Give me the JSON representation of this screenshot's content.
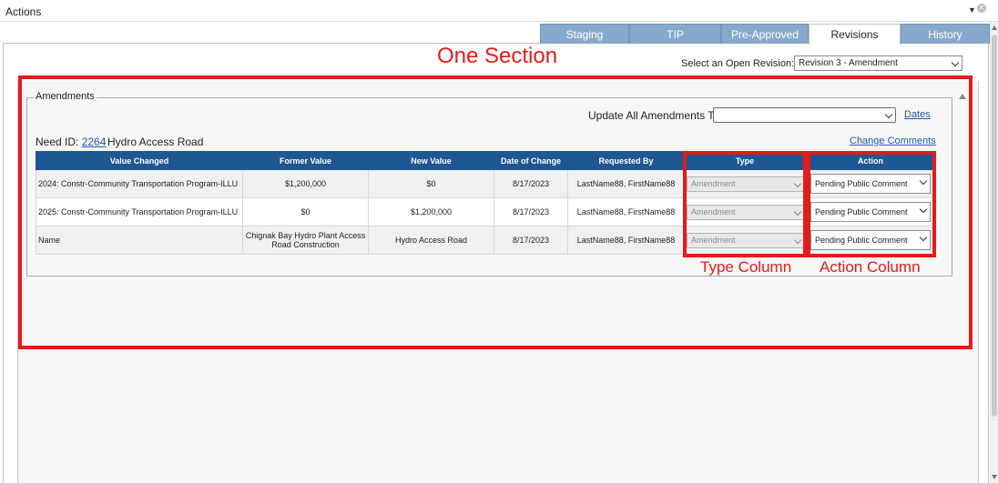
{
  "window": {
    "title": "Actions"
  },
  "tabs": [
    {
      "label": "Staging",
      "active": false
    },
    {
      "label": "TIP",
      "active": false
    },
    {
      "label": "Pre-Approved",
      "active": false
    },
    {
      "label": "Revisions",
      "active": true
    },
    {
      "label": "History",
      "active": false
    }
  ],
  "revision": {
    "label": "Select an Open Revision:",
    "selected": "Revision 3 - Amendment"
  },
  "annotations": {
    "section_title": "One Section",
    "type_column": "Type Column",
    "action_column": "Action Column",
    "color": "#e41b1b"
  },
  "amendments": {
    "legend": "Amendments",
    "update_all_label": "Update All Amendments To:",
    "update_all_value": "",
    "dates_link": "Dates",
    "need_id_label": "Need ID:",
    "need_id": "2264",
    "need_name": "Hydro Access Road",
    "change_comments_link": "Change Comments",
    "columns": [
      "Value Changed",
      "Former Value",
      "New Value",
      "Date of Change",
      "Requested By",
      "Type",
      "Action"
    ],
    "rows": [
      {
        "value_changed": "2024: Constr-Community Transportation Program-ILLU",
        "former_value": "$1,200,000",
        "new_value": "$0",
        "date_of_change": "8/17/2023",
        "requested_by": "LastName88, FirstName88",
        "type": "Amendment",
        "action": "Pending Public Comment"
      },
      {
        "value_changed": "2025: Constr-Community Transportation Program-ILLU",
        "former_value": "$0",
        "new_value": "$1,200,000",
        "date_of_change": "8/17/2023",
        "requested_by": "LastName88, FirstName88",
        "type": "Amendment",
        "action": "Pending Public Comment"
      },
      {
        "value_changed": "Name",
        "former_value": "Chignak Bay Hydro Plant Access Road Construction",
        "new_value": "Hydro Access Road",
        "date_of_change": "8/17/2023",
        "requested_by": "LastName88, FirstName88",
        "type": "Amendment",
        "action": "Pending Public Comment"
      }
    ]
  },
  "colors": {
    "header_blue": "#1f5792",
    "tab_blue": "#87a9cc",
    "link_blue": "#1f5aa6"
  }
}
